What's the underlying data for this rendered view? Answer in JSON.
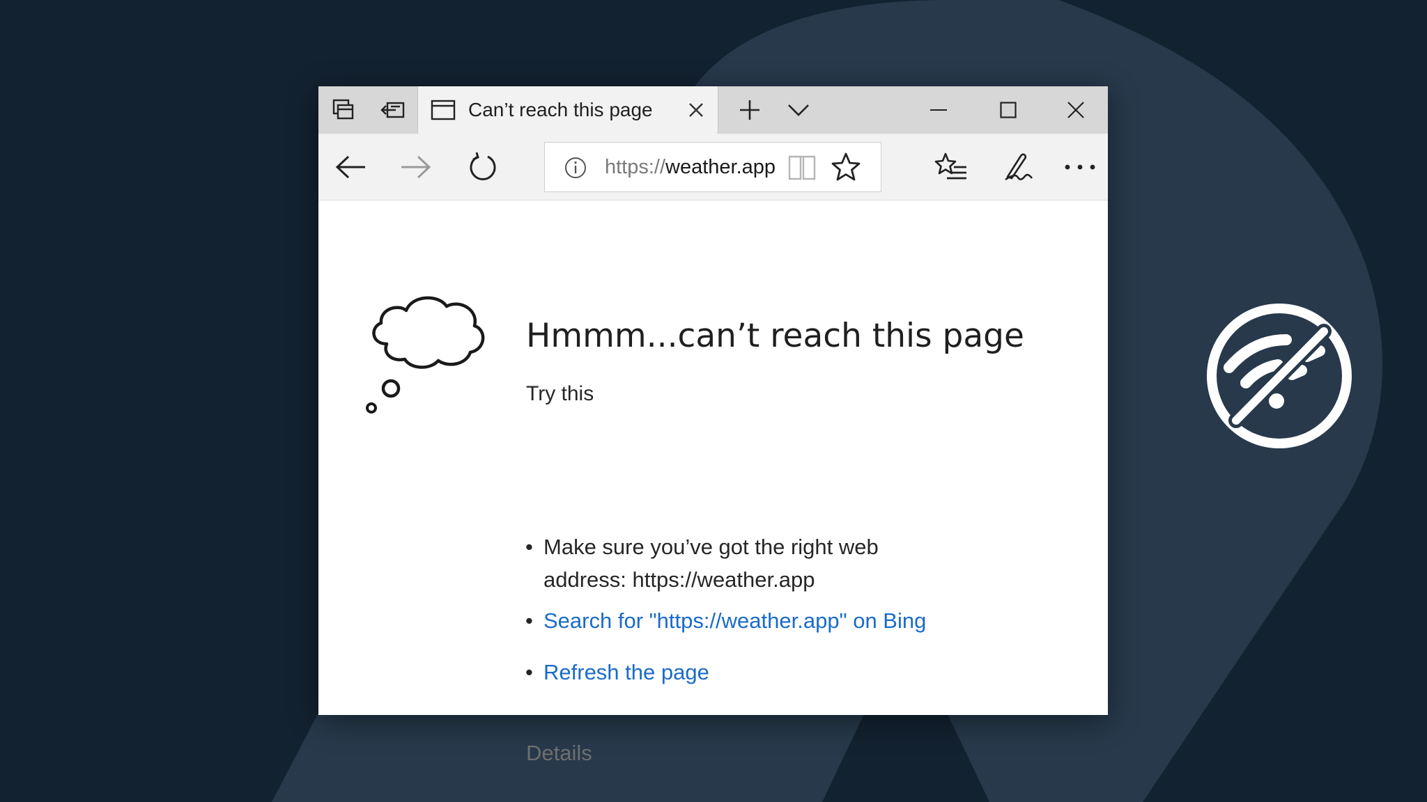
{
  "browser": {
    "tab": {
      "title": "Can’t reach this page",
      "icon": "page-icon"
    },
    "address_bar": {
      "url_scheme": "https://",
      "url_host": "weather.app"
    }
  },
  "error_page": {
    "heading": "Hmmm...can’t reach this page",
    "try_this": "Try this",
    "suggestion_1": "Make sure you’ve got the right web address: https://weather.app",
    "search_link": "Search for \"https://weather.app\" on Bing",
    "refresh_link": "Refresh the page",
    "details": "Details"
  },
  "overlay": {
    "icon": "no-wifi-icon"
  },
  "colors": {
    "background": "#132231",
    "background_shape": "#27394b",
    "link": "#1a6bc9",
    "titlebar": "#d7d7d7",
    "toolbar": "#f2f2f2"
  }
}
